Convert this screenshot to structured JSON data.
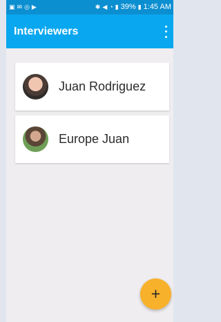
{
  "status_bar": {
    "battery_text": "39%",
    "time": "1:45 AM",
    "left_icons": [
      "gallery-icon",
      "message-icon",
      "whatsapp-icon",
      "play-icon"
    ],
    "right_icons": [
      "bluetooth-icon",
      "mute-icon",
      "wifi-icon",
      "signal-icon",
      "battery-icon"
    ]
  },
  "app_bar": {
    "title": "Interviewers",
    "menu_icon": "more-vert-icon"
  },
  "interviewers": [
    {
      "name": "Juan Rodriguez",
      "avatar": "avatar-icon"
    },
    {
      "name": "Europe Juan",
      "avatar": "avatar-icon"
    }
  ],
  "fab": {
    "label": "+"
  },
  "colors": {
    "status_bar": "#0c8fd1",
    "app_bar": "#09a7ef",
    "background": "#efedf0",
    "fab": "#f8b12b"
  }
}
